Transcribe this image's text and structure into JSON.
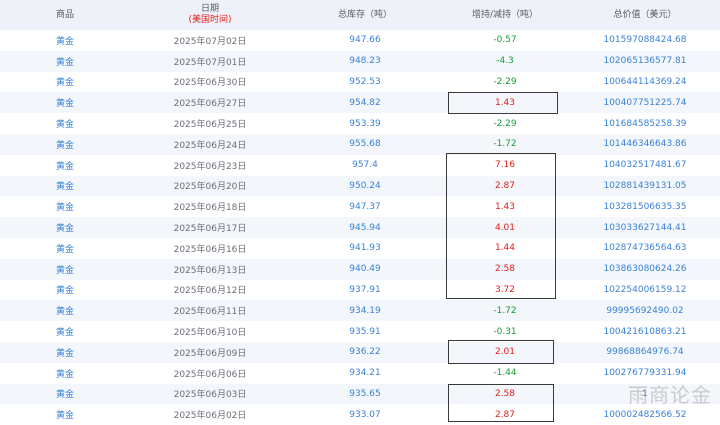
{
  "columns": {
    "commodity": "商品",
    "date": "日期",
    "date_sub": "(美国时间)",
    "stock": "总库存（吨）",
    "change": "增持/减持（吨）",
    "value": "总价值（美元）"
  },
  "rows": [
    {
      "commodity": "黄金",
      "date": "2025年07月02日",
      "stock": "947.66",
      "change": "-0.57",
      "value": "101597088424.68",
      "dir": "neg"
    },
    {
      "commodity": "黄金",
      "date": "2025年07月01日",
      "stock": "948.23",
      "change": "-4.3",
      "value": "102065136577.81",
      "dir": "neg"
    },
    {
      "commodity": "黄金",
      "date": "2025年06月30日",
      "stock": "952.53",
      "change": "-2.29",
      "value": "100644114369.24",
      "dir": "neg"
    },
    {
      "commodity": "黄金",
      "date": "2025年06月27日",
      "stock": "954.82",
      "change": "1.43",
      "value": "100407751225.74",
      "dir": "pos"
    },
    {
      "commodity": "黄金",
      "date": "2025年06月25日",
      "stock": "953.39",
      "change": "-2.29",
      "value": "101684585258.39",
      "dir": "neg"
    },
    {
      "commodity": "黄金",
      "date": "2025年06月24日",
      "stock": "955.68",
      "change": "-1.72",
      "value": "101446346643.86",
      "dir": "neg"
    },
    {
      "commodity": "黄金",
      "date": "2025年06月23日",
      "stock": "957.4",
      "change": "7.16",
      "value": "104032517481.67",
      "dir": "pos"
    },
    {
      "commodity": "黄金",
      "date": "2025年06月20日",
      "stock": "950.24",
      "change": "2.87",
      "value": "102881439131.05",
      "dir": "pos"
    },
    {
      "commodity": "黄金",
      "date": "2025年06月18日",
      "stock": "947.37",
      "change": "1.43",
      "value": "103281506635.35",
      "dir": "pos"
    },
    {
      "commodity": "黄金",
      "date": "2025年06月17日",
      "stock": "945.94",
      "change": "4.01",
      "value": "103033627144.41",
      "dir": "pos"
    },
    {
      "commodity": "黄金",
      "date": "2025年06月16日",
      "stock": "941.93",
      "change": "1.44",
      "value": "102874736564.63",
      "dir": "pos"
    },
    {
      "commodity": "黄金",
      "date": "2025年06月13日",
      "stock": "940.49",
      "change": "2.58",
      "value": "103863080624.26",
      "dir": "pos"
    },
    {
      "commodity": "黄金",
      "date": "2025年06月12日",
      "stock": "937.91",
      "change": "3.72",
      "value": "102254006159.12",
      "dir": "pos"
    },
    {
      "commodity": "黄金",
      "date": "2025年06月11日",
      "stock": "934.19",
      "change": "-1.72",
      "value": "99995692490.02",
      "dir": "neg"
    },
    {
      "commodity": "黄金",
      "date": "2025年06月10日",
      "stock": "935.91",
      "change": "-0.31",
      "value": "100421610863.21",
      "dir": "neg"
    },
    {
      "commodity": "黄金",
      "date": "2025年06月09日",
      "stock": "936.22",
      "change": "2.01",
      "value": "99868864976.74",
      "dir": "pos"
    },
    {
      "commodity": "黄金",
      "date": "2025年06月06日",
      "stock": "934.21",
      "change": "-1.44",
      "value": "100276779331.94",
      "dir": "neg"
    },
    {
      "commodity": "黄金",
      "date": "2025年06月03日",
      "stock": "935.65",
      "change": "2.58",
      "value": "1",
      "dir": "pos"
    },
    {
      "commodity": "黄金",
      "date": "2025年06月02日",
      "stock": "933.07",
      "change": "2.87",
      "value": "100002482566.52",
      "dir": "pos"
    }
  ],
  "colors": {
    "header_bg": "#eef2f8",
    "link_blue": "#3a82d6",
    "increase_red": "#e0201a",
    "decrease_green": "#1a9a3a",
    "date_sub_red": "#e02020"
  },
  "watermark": "雨商论金"
}
